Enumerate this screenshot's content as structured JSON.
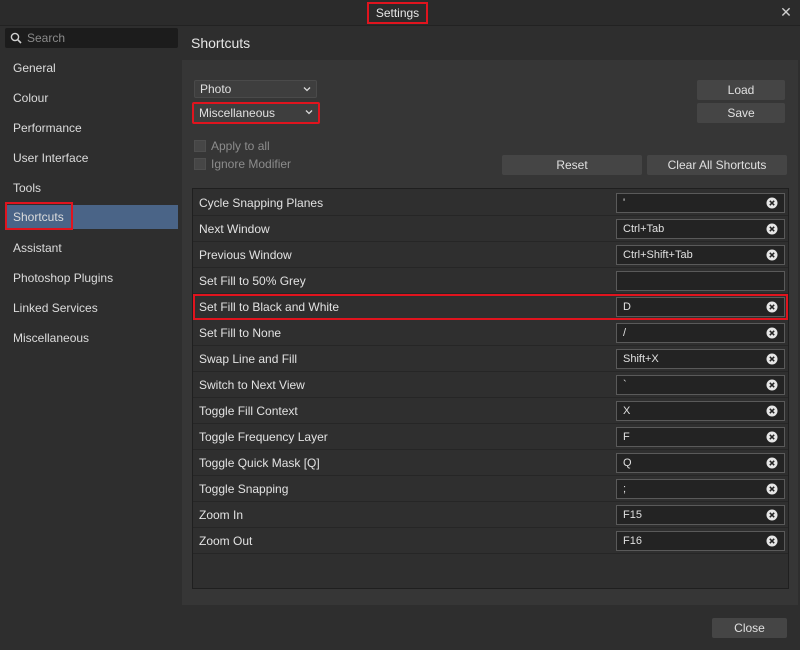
{
  "window": {
    "title": "Settings",
    "close_glyph": "✕"
  },
  "search": {
    "placeholder": "Search"
  },
  "sidebar": {
    "items": [
      {
        "label": "General"
      },
      {
        "label": "Colour"
      },
      {
        "label": "Performance"
      },
      {
        "label": "User Interface"
      },
      {
        "label": "Tools"
      },
      {
        "label": "Shortcuts",
        "active": true
      },
      {
        "label": "Assistant"
      },
      {
        "label": "Photoshop Plugins"
      },
      {
        "label": "Linked Services"
      },
      {
        "label": "Miscellaneous"
      }
    ]
  },
  "page": {
    "title": "Shortcuts"
  },
  "controls": {
    "persona_select": "Photo",
    "category_select": "Miscellaneous",
    "apply_to_all": "Apply to all",
    "ignore_modifier": "Ignore Modifier",
    "load": "Load",
    "save": "Save",
    "reset": "Reset",
    "clear_all": "Clear All Shortcuts"
  },
  "shortcuts": [
    {
      "name": "Cycle Snapping Planes",
      "key": "'"
    },
    {
      "name": "Next Window",
      "key": "Ctrl+Tab"
    },
    {
      "name": "Previous Window",
      "key": "Ctrl+Shift+Tab"
    },
    {
      "name": "Set Fill to 50% Grey",
      "key": ""
    },
    {
      "name": "Set Fill to Black and White",
      "key": "D",
      "highlighted": true
    },
    {
      "name": "Set Fill to None",
      "key": "/"
    },
    {
      "name": "Swap Line and Fill",
      "key": "Shift+X"
    },
    {
      "name": "Switch to Next View",
      "key": "`"
    },
    {
      "name": "Toggle Fill Context",
      "key": "X"
    },
    {
      "name": "Toggle Frequency Layer",
      "key": "F"
    },
    {
      "name": "Toggle Quick Mask [Q]",
      "key": "Q"
    },
    {
      "name": "Toggle Snapping",
      "key": ";"
    },
    {
      "name": "Zoom In",
      "key": "F15"
    },
    {
      "name": "Zoom Out",
      "key": "F16"
    }
  ],
  "footer": {
    "close": "Close"
  },
  "colors": {
    "accent": "#4a6487",
    "highlight": "#e0141e",
    "background": "#2e2e2e"
  }
}
